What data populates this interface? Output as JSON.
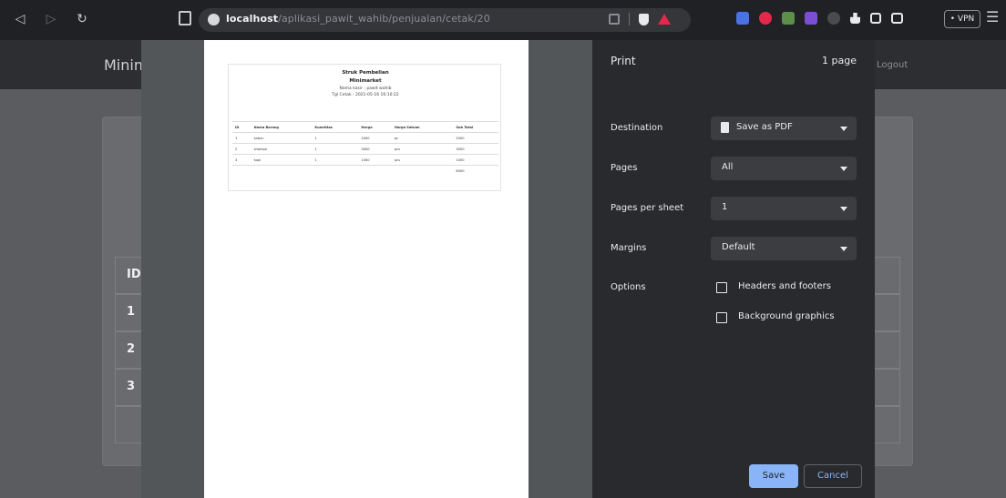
{
  "browser": {
    "url_host": "localhost",
    "url_path": "/aplikasi_pawit_wahib/penjualan/cetak/20",
    "vpn_label": "• VPN",
    "extension_colors": [
      "#4a72e0",
      "#e3284b",
      "#5d8f4a",
      "#7b4fd1",
      "#8a8d92"
    ]
  },
  "page": {
    "brand": "Minim",
    "nav_right": "Logout",
    "table_rows": [
      "ID",
      "1",
      "2",
      "3",
      ""
    ]
  },
  "preview": {
    "receipt": {
      "title": "Struk Pembelian",
      "store": "Minimarket",
      "cashier": "Nama kasir : pawit wahib",
      "date": "Tgl Cetak : 2021-05-16 16:10:22"
    },
    "table": {
      "headers": [
        "ID",
        "Nama Barang",
        "Kuantitas",
        "Harga",
        "Harga Satuan",
        "Sub Total"
      ],
      "rows": [
        [
          "1",
          "sabun",
          "1",
          "2000",
          "pc",
          "2000"
        ],
        [
          "2",
          "shampo",
          "1",
          "3000",
          "pcs",
          "3000"
        ],
        [
          "3",
          "kopi",
          "1",
          "1000",
          "pcs",
          "1000"
        ],
        [
          "",
          "",
          "",
          "",
          "",
          "6000"
        ]
      ]
    }
  },
  "print_panel": {
    "title": "Print",
    "page_count": "1 page",
    "destination_label": "Destination",
    "destination_value": "Save as PDF",
    "pages_label": "Pages",
    "pages_value": "All",
    "pages_per_sheet_label": "Pages per sheet",
    "pages_per_sheet_value": "1",
    "margins_label": "Margins",
    "margins_value": "Default",
    "options_label": "Options",
    "option_headers": "Headers and footers",
    "option_background": "Background graphics",
    "save_label": "Save",
    "cancel_label": "Cancel"
  }
}
